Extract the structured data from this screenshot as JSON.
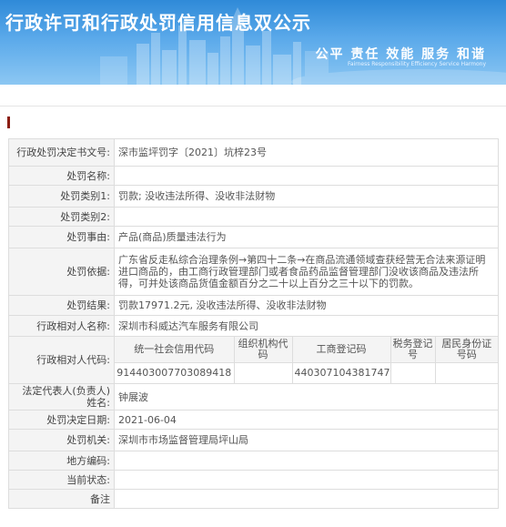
{
  "header": {
    "title": "行政许可和行政处罚信用信息双公示",
    "motto": "公平  责任  效能  服务  和谐",
    "motto_en": "Fairness  Responsibility  Efficiency  Service  Harmony"
  },
  "record": {
    "rows": [
      {
        "label": "行政处罚决定书文号:",
        "value": "深市监坪罚字〔2021〕坑梓23号"
      },
      {
        "label": "处罚名称:",
        "value": ""
      },
      {
        "label": "处罚类别1:",
        "value": "罚款; 没收违法所得、没收非法财物"
      },
      {
        "label": "处罚类别2:",
        "value": ""
      },
      {
        "label": "处罚事由:",
        "value": "产品(商品)质量违法行为"
      },
      {
        "label": "处罚依据:",
        "value": "广东省反走私综合治理条例→第四十二条→在商品流通领域查获经营无合法来源证明进口商品的，由工商行政管理部门或者食品药品监督管理部门没收该商品及违法所得，可并处该商品货值金额百分之二十以上百分之三十以下的罚款。"
      },
      {
        "label": "处罚结果:",
        "value": "罚款17971.2元, 没收违法所得、没收非法财物"
      },
      {
        "label": "行政相对人名称:",
        "value": "深圳市科威达汽车服务有限公司"
      }
    ],
    "code_label": "行政相对人代码:",
    "code_headers": [
      "统一社会信用代码",
      "组织机构代码",
      "工商登记码",
      "税务登记号",
      "居民身份证号码"
    ],
    "code_values": [
      "91440300770308941​8",
      "",
      "440307104381747",
      "",
      ""
    ],
    "rows2": [
      {
        "label": "法定代表人(负责人)姓名:",
        "value": "钟展波"
      },
      {
        "label": "处罚决定日期:",
        "value": "2021-06-04"
      },
      {
        "label": "处罚机关:",
        "value": "深圳市市场监督管理局坪山局"
      },
      {
        "label": "地方编码:",
        "value": ""
      },
      {
        "label": "当前状态:",
        "value": ""
      },
      {
        "label": "备注",
        "value": ""
      }
    ]
  },
  "colors": {
    "header_top": "#2f8ad8",
    "header_bottom": "#8cc7f3",
    "label_bg": "#f4f4f4",
    "accent_mark": "#8b1d12"
  }
}
